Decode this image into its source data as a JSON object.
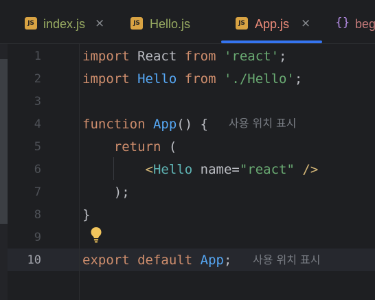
{
  "tabs": [
    {
      "label": "index.js",
      "icon": "js-file-icon",
      "icon_text": "JS",
      "close": "×"
    },
    {
      "label": "Hello.js",
      "icon": "js-file-icon",
      "icon_text": "JS"
    },
    {
      "label": "App.js",
      "icon": "js-file-icon",
      "icon_text": "JS",
      "close": "×",
      "active": true
    },
    {
      "label": "beg",
      "icon": "json-file-icon",
      "icon_text": "{}"
    }
  ],
  "editor": {
    "current_line": 10,
    "line_numbers": [
      "1",
      "2",
      "3",
      "4",
      "5",
      "6",
      "7",
      "8",
      "9",
      "10"
    ],
    "lines": [
      [
        {
          "t": "kw",
          "v": "import"
        },
        {
          "t": "plain",
          "v": " React "
        },
        {
          "t": "kw",
          "v": "from"
        },
        {
          "t": "plain",
          "v": " "
        },
        {
          "t": "str",
          "v": "'react'"
        },
        {
          "t": "plain",
          "v": ";"
        }
      ],
      [
        {
          "t": "kw",
          "v": "import"
        },
        {
          "t": "plain",
          "v": " "
        },
        {
          "t": "fn",
          "v": "Hello"
        },
        {
          "t": "plain",
          "v": " "
        },
        {
          "t": "kw",
          "v": "from"
        },
        {
          "t": "plain",
          "v": " "
        },
        {
          "t": "str",
          "v": "'./Hello'"
        },
        {
          "t": "plain",
          "v": ";"
        }
      ],
      [],
      [
        {
          "t": "kw",
          "v": "function"
        },
        {
          "t": "plain",
          "v": " "
        },
        {
          "t": "fn",
          "v": "App"
        },
        {
          "t": "plain",
          "v": "() {"
        }
      ],
      [
        {
          "t": "plain",
          "v": "    "
        },
        {
          "t": "kw",
          "v": "return"
        },
        {
          "t": "plain",
          "v": " ("
        }
      ],
      [
        {
          "t": "plain",
          "v": "        "
        },
        {
          "t": "tagbr",
          "v": "<"
        },
        {
          "t": "tag",
          "v": "Hello"
        },
        {
          "t": "plain",
          "v": " "
        },
        {
          "t": "attr",
          "v": "name"
        },
        {
          "t": "plain",
          "v": "="
        },
        {
          "t": "str",
          "v": "\"react\""
        },
        {
          "t": "plain",
          "v": " "
        },
        {
          "t": "tagbr",
          "v": "/>"
        }
      ],
      [
        {
          "t": "plain",
          "v": "    );"
        }
      ],
      [
        {
          "t": "plain",
          "v": "}"
        }
      ],
      [],
      [
        {
          "t": "kw",
          "v": "export"
        },
        {
          "t": "plain",
          "v": " "
        },
        {
          "t": "kw",
          "v": "default"
        },
        {
          "t": "plain",
          "v": " "
        },
        {
          "t": "fn",
          "v": "App"
        },
        {
          "t": "plain",
          "v": ";"
        }
      ]
    ],
    "usage_hint_line4": "사용 위치 표시",
    "usage_hint_line10": "사용 위치 표시",
    "intention_icon": "lightbulb-icon"
  },
  "colors": {
    "keyword": "#cf8e6d",
    "string": "#6aab73",
    "function": "#56a8f5",
    "text": "#bcbec4",
    "tag": "#5fb4b4",
    "active_tab_underline": "#3574f0"
  }
}
